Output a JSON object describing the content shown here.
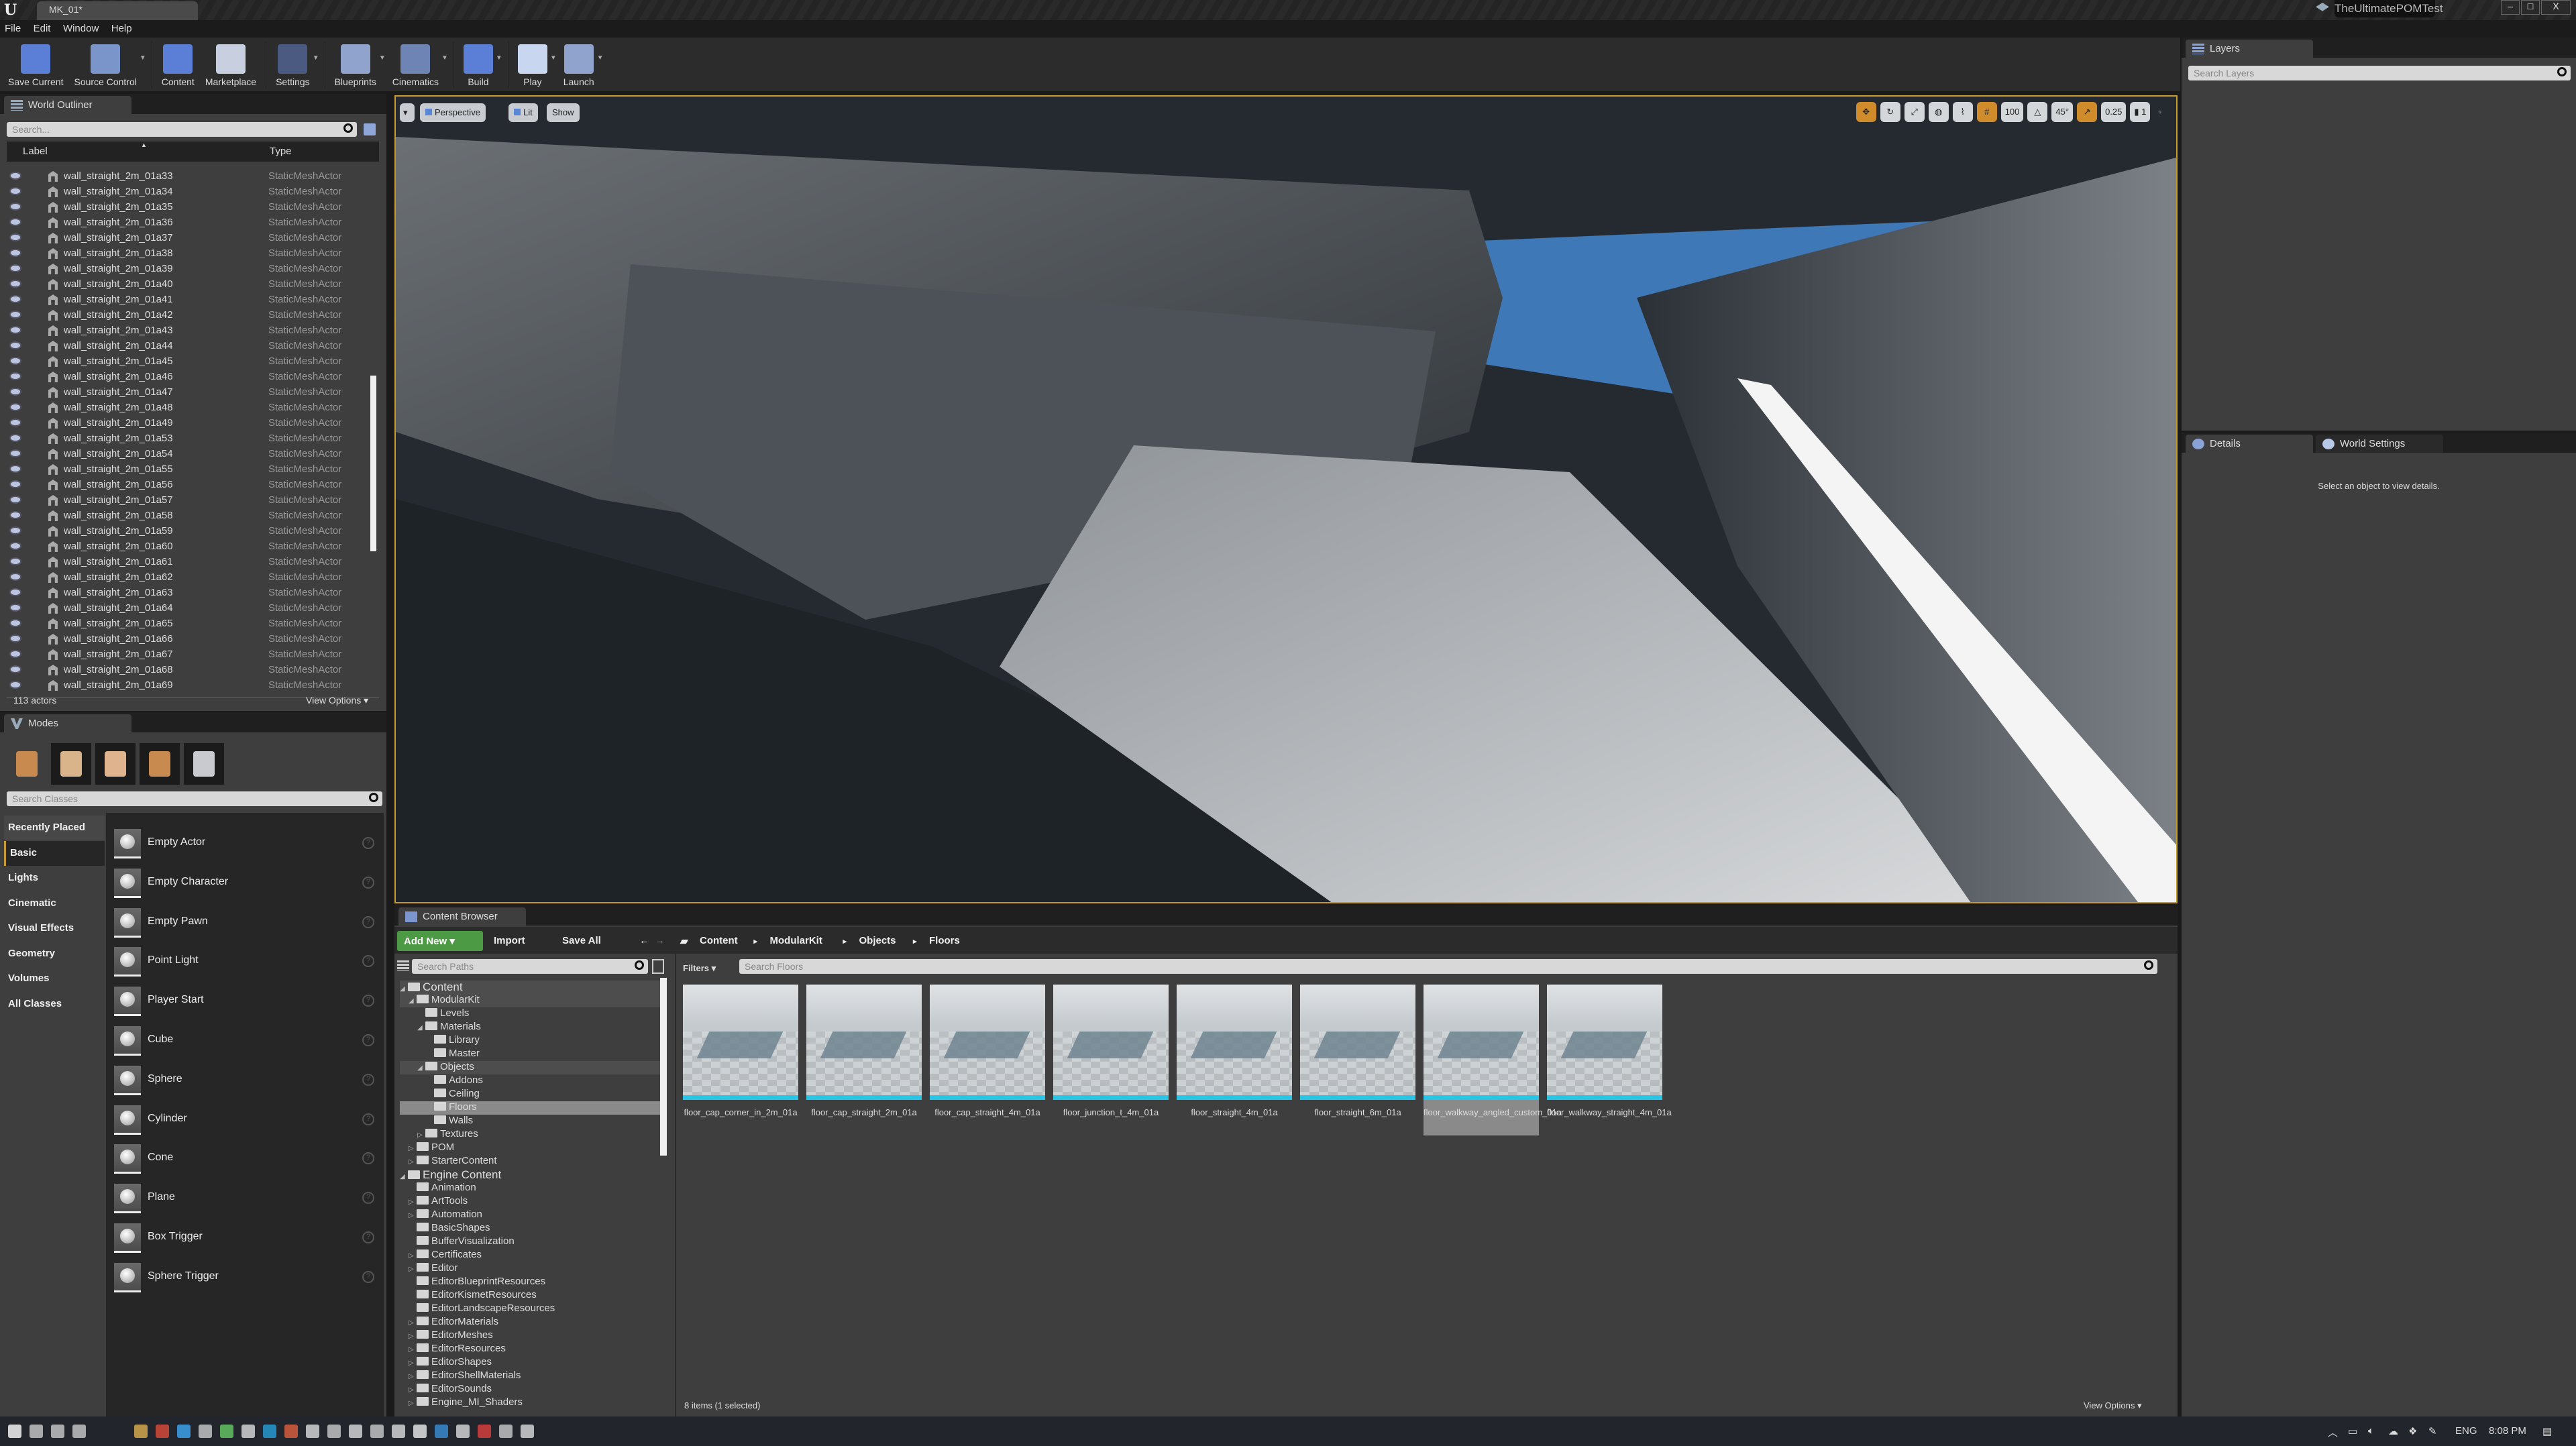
{
  "titlebar": {
    "doc_tab": "MK_01*",
    "project": "TheUltimatePOMTest",
    "min": "–",
    "max": "□",
    "close": "X"
  },
  "menu": [
    "File",
    "Edit",
    "Window",
    "Help"
  ],
  "toolbar": [
    {
      "label": "Save Current",
      "icon": "save-icon",
      "color": "#5b7fd6",
      "dropdown": false
    },
    {
      "label": "Source Control",
      "icon": "source-control-icon",
      "color": "#7a95c9",
      "dropdown": true
    },
    {
      "label": "Content",
      "icon": "content-icon",
      "color": "#5b7fd6",
      "dropdown": false
    },
    {
      "label": "Marketplace",
      "icon": "marketplace-icon",
      "color": "#c8d0e0",
      "dropdown": false
    },
    {
      "label": "Settings",
      "icon": "gear-icon",
      "color": "#4b5a80",
      "dropdown": true
    },
    {
      "label": "Blueprints",
      "icon": "blueprint-icon",
      "color": "#8fa3cc",
      "dropdown": true
    },
    {
      "label": "Cinematics",
      "icon": "clapper-icon",
      "color": "#6d84b5",
      "dropdown": true
    },
    {
      "label": "Build",
      "icon": "build-icon",
      "color": "#5b7fd6",
      "dropdown": true
    },
    {
      "label": "Play",
      "icon": "play-icon",
      "color": "#c8d6ef",
      "dropdown": true
    },
    {
      "label": "Launch",
      "icon": "launch-icon",
      "color": "#8fa3cc",
      "dropdown": true
    }
  ],
  "outliner": {
    "tab": "World Outliner",
    "search_placeholder": "Search...",
    "col_label": "Label",
    "col_type": "Type",
    "rows": [
      {
        "label": "wall_straight_2m_01a33",
        "type": "StaticMeshActor"
      },
      {
        "label": "wall_straight_2m_01a34",
        "type": "StaticMeshActor"
      },
      {
        "label": "wall_straight_2m_01a35",
        "type": "StaticMeshActor"
      },
      {
        "label": "wall_straight_2m_01a36",
        "type": "StaticMeshActor"
      },
      {
        "label": "wall_straight_2m_01a37",
        "type": "StaticMeshActor"
      },
      {
        "label": "wall_straight_2m_01a38",
        "type": "StaticMeshActor"
      },
      {
        "label": "wall_straight_2m_01a39",
        "type": "StaticMeshActor"
      },
      {
        "label": "wall_straight_2m_01a40",
        "type": "StaticMeshActor"
      },
      {
        "label": "wall_straight_2m_01a41",
        "type": "StaticMeshActor"
      },
      {
        "label": "wall_straight_2m_01a42",
        "type": "StaticMeshActor"
      },
      {
        "label": "wall_straight_2m_01a43",
        "type": "StaticMeshActor"
      },
      {
        "label": "wall_straight_2m_01a44",
        "type": "StaticMeshActor"
      },
      {
        "label": "wall_straight_2m_01a45",
        "type": "StaticMeshActor"
      },
      {
        "label": "wall_straight_2m_01a46",
        "type": "StaticMeshActor"
      },
      {
        "label": "wall_straight_2m_01a47",
        "type": "StaticMeshActor"
      },
      {
        "label": "wall_straight_2m_01a48",
        "type": "StaticMeshActor"
      },
      {
        "label": "wall_straight_2m_01a49",
        "type": "StaticMeshActor"
      },
      {
        "label": "wall_straight_2m_01a53",
        "type": "StaticMeshActor"
      },
      {
        "label": "wall_straight_2m_01a54",
        "type": "StaticMeshActor"
      },
      {
        "label": "wall_straight_2m_01a55",
        "type": "StaticMeshActor"
      },
      {
        "label": "wall_straight_2m_01a56",
        "type": "StaticMeshActor"
      },
      {
        "label": "wall_straight_2m_01a57",
        "type": "StaticMeshActor"
      },
      {
        "label": "wall_straight_2m_01a58",
        "type": "StaticMeshActor"
      },
      {
        "label": "wall_straight_2m_01a59",
        "type": "StaticMeshActor"
      },
      {
        "label": "wall_straight_2m_01a60",
        "type": "StaticMeshActor"
      },
      {
        "label": "wall_straight_2m_01a61",
        "type": "StaticMeshActor"
      },
      {
        "label": "wall_straight_2m_01a62",
        "type": "StaticMeshActor"
      },
      {
        "label": "wall_straight_2m_01a63",
        "type": "StaticMeshActor"
      },
      {
        "label": "wall_straight_2m_01a64",
        "type": "StaticMeshActor"
      },
      {
        "label": "wall_straight_2m_01a65",
        "type": "StaticMeshActor"
      },
      {
        "label": "wall_straight_2m_01a66",
        "type": "StaticMeshActor"
      },
      {
        "label": "wall_straight_2m_01a67",
        "type": "StaticMeshActor"
      },
      {
        "label": "wall_straight_2m_01a68",
        "type": "StaticMeshActor"
      },
      {
        "label": "wall_straight_2m_01a69",
        "type": "StaticMeshActor"
      }
    ],
    "count": "113 actors",
    "view_options": "View Options ▾"
  },
  "modes": {
    "tab": "Modes",
    "search_placeholder": "Search Classes",
    "tools": [
      "place-mode-icon",
      "paint-mode-icon",
      "landscape-mode-icon",
      "foliage-mode-icon",
      "geometry-mode-icon"
    ],
    "categories": [
      "Recently Placed",
      "Basic",
      "Lights",
      "Cinematic",
      "Visual Effects",
      "Geometry",
      "Volumes",
      "All Classes"
    ],
    "active_category": "Basic",
    "items": [
      "Empty Actor",
      "Empty Character",
      "Empty Pawn",
      "Point Light",
      "Player Start",
      "Cube",
      "Sphere",
      "Cylinder",
      "Cone",
      "Plane",
      "Box Trigger",
      "Sphere Trigger"
    ],
    "help": "?"
  },
  "viewport": {
    "menu": "▾",
    "perspective": "Perspective",
    "lit": "Lit",
    "show": "Show",
    "grid_snap": "100",
    "rotation_snap": "45°",
    "scale_snap": "0.25",
    "camera_speed": "1",
    "accent": "#d08c2a"
  },
  "content_browser": {
    "tab": "Content Browser",
    "add_new": "Add New ▾",
    "import": "Import",
    "save_all": "Save All",
    "back": "←",
    "forward": "→",
    "breadcrumb": [
      "Content",
      "ModularKit",
      "Objects",
      "Floors"
    ],
    "search_paths_placeholder": "Search Paths",
    "filters": "Filters ▾",
    "search_placeholder": "Search Floors",
    "tree": [
      {
        "label": "Content",
        "depth": 0,
        "expand": "open"
      },
      {
        "label": "ModularKit",
        "depth": 1,
        "expand": "open"
      },
      {
        "label": "Levels",
        "depth": 2,
        "expand": ""
      },
      {
        "label": "Materials",
        "depth": 2,
        "expand": "open"
      },
      {
        "label": "Library",
        "depth": 3,
        "expand": ""
      },
      {
        "label": "Master",
        "depth": 3,
        "expand": ""
      },
      {
        "label": "Objects",
        "depth": 2,
        "expand": "open"
      },
      {
        "label": "Addons",
        "depth": 3,
        "expand": ""
      },
      {
        "label": "Ceiling",
        "depth": 3,
        "expand": ""
      },
      {
        "label": "Floors",
        "depth": 3,
        "expand": "",
        "selected": true
      },
      {
        "label": "Walls",
        "depth": 3,
        "expand": ""
      },
      {
        "label": "Textures",
        "depth": 2,
        "expand": "closed"
      },
      {
        "label": "POM",
        "depth": 1,
        "expand": "closed"
      },
      {
        "label": "StarterContent",
        "depth": 1,
        "expand": "closed"
      },
      {
        "label": "Engine Content",
        "depth": 0,
        "expand": "open"
      },
      {
        "label": "Animation",
        "depth": 1,
        "expand": ""
      },
      {
        "label": "ArtTools",
        "depth": 1,
        "expand": "closed"
      },
      {
        "label": "Automation",
        "depth": 1,
        "expand": "closed"
      },
      {
        "label": "BasicShapes",
        "depth": 1,
        "expand": ""
      },
      {
        "label": "BufferVisualization",
        "depth": 1,
        "expand": ""
      },
      {
        "label": "Certificates",
        "depth": 1,
        "expand": "closed"
      },
      {
        "label": "Editor",
        "depth": 1,
        "expand": "closed"
      },
      {
        "label": "EditorBlueprintResources",
        "depth": 1,
        "expand": ""
      },
      {
        "label": "EditorKismetResources",
        "depth": 1,
        "expand": ""
      },
      {
        "label": "EditorLandscapeResources",
        "depth": 1,
        "expand": ""
      },
      {
        "label": "EditorMaterials",
        "depth": 1,
        "expand": "closed"
      },
      {
        "label": "EditorMeshes",
        "depth": 1,
        "expand": "closed"
      },
      {
        "label": "EditorResources",
        "depth": 1,
        "expand": "closed"
      },
      {
        "label": "EditorShapes",
        "depth": 1,
        "expand": "closed"
      },
      {
        "label": "EditorShellMaterials",
        "depth": 1,
        "expand": "closed"
      },
      {
        "label": "EditorSounds",
        "depth": 1,
        "expand": "closed"
      },
      {
        "label": "Engine_MI_Shaders",
        "depth": 1,
        "expand": "closed"
      }
    ],
    "assets": [
      {
        "name": "floor_cap_corner_in_2m_01a"
      },
      {
        "name": "floor_cap_straight_2m_01a"
      },
      {
        "name": "floor_cap_straight_4m_01a"
      },
      {
        "name": "floor_junction_t_4m_01a"
      },
      {
        "name": "floor_straight_4m_01a"
      },
      {
        "name": "floor_straight_6m_01a"
      },
      {
        "name": "floor_walkway_angled_custom_01a",
        "selected": true
      },
      {
        "name": "floor_walkway_straight_4m_01a"
      }
    ],
    "status": "8 items (1 selected)",
    "view_options": "View Options ▾",
    "asset_accent": "#27c6e6"
  },
  "layers": {
    "tab": "Layers",
    "search_placeholder": "Search Layers"
  },
  "details": {
    "tab": "Details",
    "tab2": "World Settings",
    "empty": "Select an object to view details."
  },
  "taskbar": {
    "lang": "ENG",
    "time": "8:08 PM"
  }
}
